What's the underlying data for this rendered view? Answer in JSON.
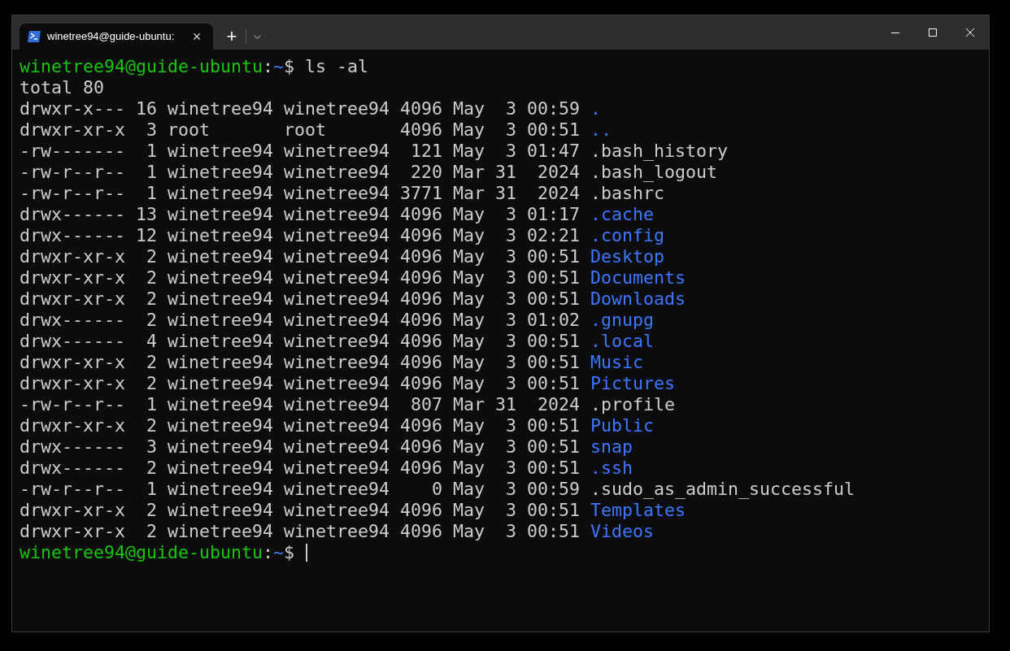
{
  "tab": {
    "title": "winetree94@guide-ubuntu:",
    "selected": true,
    "close": "×"
  },
  "new_tab": "+",
  "lines": [
    {
      "kind": "prompt",
      "user_host": "winetree94@guide-ubuntu",
      "sep": ":",
      "path": "~",
      "symbol": "$",
      "command": "ls -al"
    },
    {
      "kind": "output",
      "text": "total 80"
    },
    {
      "kind": "entry",
      "info": "drwxr-x--- 16 winetree94 winetree94 4096 May  3 00:59",
      "name": ".",
      "directory": true
    },
    {
      "kind": "entry",
      "info": "drwxr-xr-x  3 root       root       4096 May  3 00:51",
      "name": "..",
      "directory": true
    },
    {
      "kind": "entry",
      "info": "-rw-------  1 winetree94 winetree94  121 May  3 01:47",
      "name": ".bash_history",
      "directory": false
    },
    {
      "kind": "entry",
      "info": "-rw-r--r--  1 winetree94 winetree94  220 Mar 31  2024",
      "name": ".bash_logout",
      "directory": false
    },
    {
      "kind": "entry",
      "info": "-rw-r--r--  1 winetree94 winetree94 3771 Mar 31  2024",
      "name": ".bashrc",
      "directory": false
    },
    {
      "kind": "entry",
      "info": "drwx------ 13 winetree94 winetree94 4096 May  3 01:17",
      "name": ".cache",
      "directory": true
    },
    {
      "kind": "entry",
      "info": "drwx------ 12 winetree94 winetree94 4096 May  3 02:21",
      "name": ".config",
      "directory": true
    },
    {
      "kind": "entry",
      "info": "drwxr-xr-x  2 winetree94 winetree94 4096 May  3 00:51",
      "name": "Desktop",
      "directory": true
    },
    {
      "kind": "entry",
      "info": "drwxr-xr-x  2 winetree94 winetree94 4096 May  3 00:51",
      "name": "Documents",
      "directory": true
    },
    {
      "kind": "entry",
      "info": "drwxr-xr-x  2 winetree94 winetree94 4096 May  3 00:51",
      "name": "Downloads",
      "directory": true
    },
    {
      "kind": "entry",
      "info": "drwx------  2 winetree94 winetree94 4096 May  3 01:02",
      "name": ".gnupg",
      "directory": true
    },
    {
      "kind": "entry",
      "info": "drwx------  4 winetree94 winetree94 4096 May  3 00:51",
      "name": ".local",
      "directory": true
    },
    {
      "kind": "entry",
      "info": "drwxr-xr-x  2 winetree94 winetree94 4096 May  3 00:51",
      "name": "Music",
      "directory": true
    },
    {
      "kind": "entry",
      "info": "drwxr-xr-x  2 winetree94 winetree94 4096 May  3 00:51",
      "name": "Pictures",
      "directory": true
    },
    {
      "kind": "entry",
      "info": "-rw-r--r--  1 winetree94 winetree94  807 Mar 31  2024",
      "name": ".profile",
      "directory": false
    },
    {
      "kind": "entry",
      "info": "drwxr-xr-x  2 winetree94 winetree94 4096 May  3 00:51",
      "name": "Public",
      "directory": true
    },
    {
      "kind": "entry",
      "info": "drwx------  3 winetree94 winetree94 4096 May  3 00:51",
      "name": "snap",
      "directory": true
    },
    {
      "kind": "entry",
      "info": "drwx------  2 winetree94 winetree94 4096 May  3 00:51",
      "name": ".ssh",
      "directory": true
    },
    {
      "kind": "entry",
      "info": "-rw-r--r--  1 winetree94 winetree94    0 May  3 00:59",
      "name": ".sudo_as_admin_successful",
      "directory": false
    },
    {
      "kind": "entry",
      "info": "drwxr-xr-x  2 winetree94 winetree94 4096 May  3 00:51",
      "name": "Templates",
      "directory": true
    },
    {
      "kind": "entry",
      "info": "drwxr-xr-x  2 winetree94 winetree94 4096 May  3 00:51",
      "name": "Videos",
      "directory": true
    },
    {
      "kind": "prompt",
      "user_host": "winetree94@guide-ubuntu",
      "sep": ":",
      "path": "~",
      "symbol": "$",
      "cursor": true
    }
  ]
}
